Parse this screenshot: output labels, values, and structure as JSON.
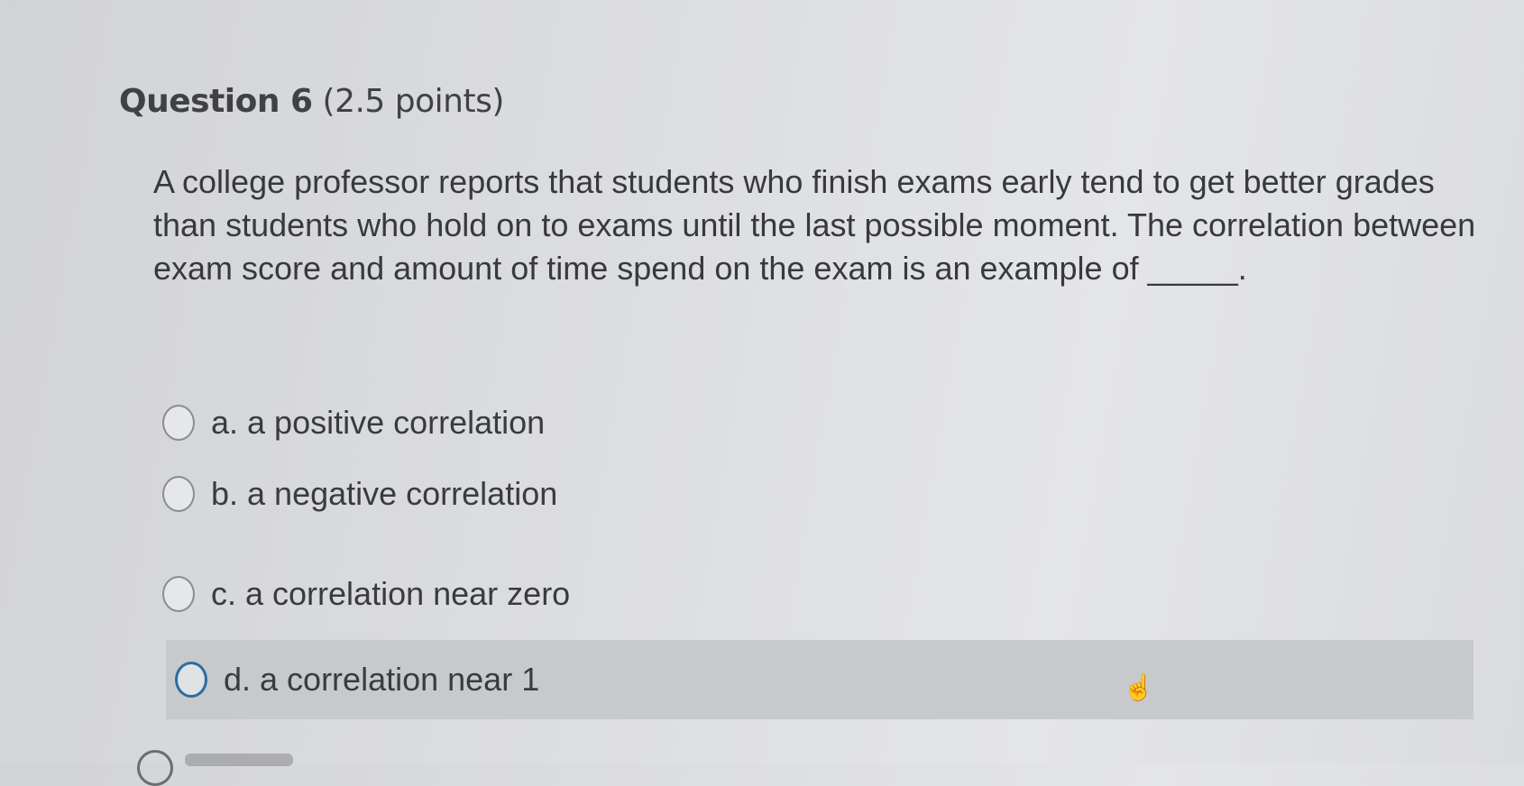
{
  "question": {
    "label": "Question 6",
    "points": "(2.5 points)",
    "text": "A college professor reports that students who finish exams early tend to get better grades than students who hold on to exams until the last possible moment. The correlation between exam score and amount of time spend on the exam is an example of _____.",
    "options": [
      {
        "text": "a. a positive correlation"
      },
      {
        "text": "b. a negative correlation"
      },
      {
        "text": "c. a correlation near zero"
      },
      {
        "text": "d. a correlation near 1"
      }
    ]
  }
}
